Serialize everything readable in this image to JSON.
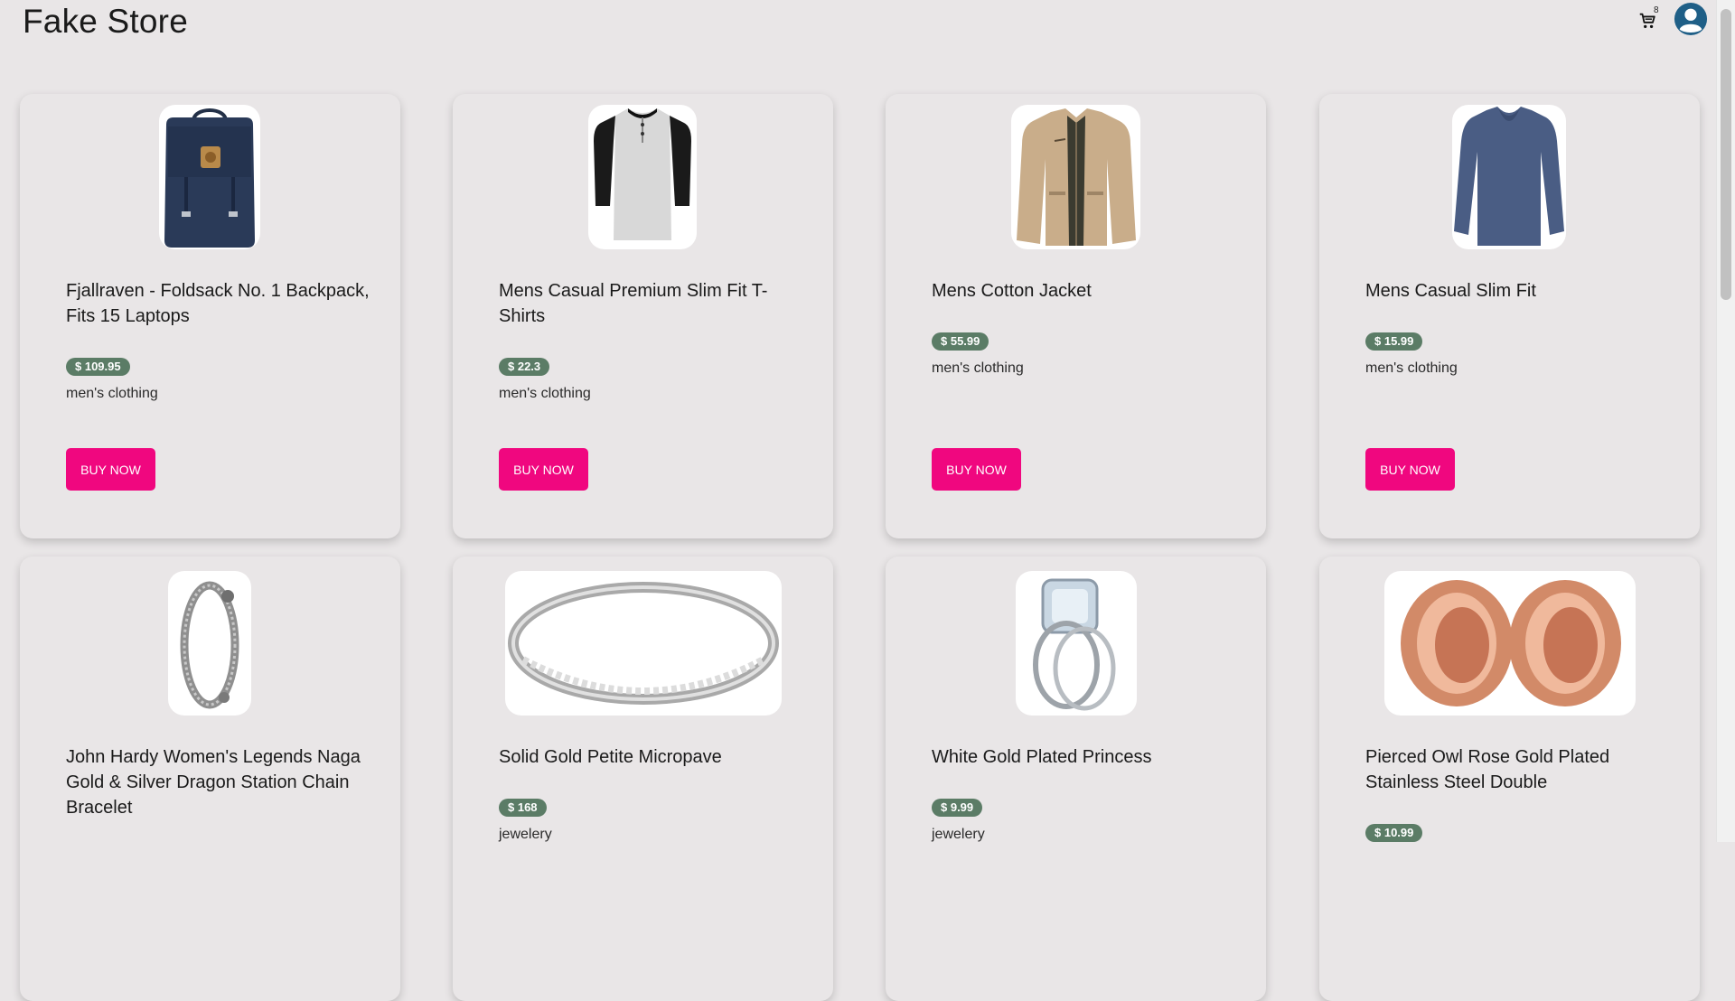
{
  "header": {
    "title": "Fake Store",
    "cart_count": "8",
    "icons": [
      "cart-icon",
      "account-avatar-icon"
    ]
  },
  "colors": {
    "price_badge": "#5b7c66",
    "buy_button": "#f0077f",
    "background": "#e9e6e7",
    "avatar": "#1f5f87"
  },
  "products": [
    {
      "title": "Fjallraven - Foldsack No. 1 Backpack, Fits 15 Laptops",
      "price": "$ 109.95",
      "category": "men's clothing",
      "button": "BUY NOW",
      "image_icon": "backpack-icon"
    },
    {
      "title": "Mens Casual Premium Slim Fit T-Shirts",
      "price": "$ 22.3",
      "category": "men's clothing",
      "button": "BUY NOW",
      "image_icon": "raglan-tshirt-icon"
    },
    {
      "title": "Mens Cotton Jacket",
      "price": "$ 55.99",
      "category": "men's clothing",
      "button": "BUY NOW",
      "image_icon": "jacket-icon"
    },
    {
      "title": "Mens Casual Slim Fit",
      "price": "$ 15.99",
      "category": "men's clothing",
      "button": "BUY NOW",
      "image_icon": "longsleeve-shirt-icon"
    },
    {
      "title": "John Hardy Women's Legends Naga Gold & Silver Dragon Station Chain Bracelet",
      "price": "",
      "category": "",
      "button": "",
      "image_icon": "bracelet-icon"
    },
    {
      "title": "Solid Gold Petite Micropave",
      "price": "$ 168",
      "category": "jewelery",
      "button": "",
      "image_icon": "ring-icon"
    },
    {
      "title": "White Gold Plated Princess",
      "price": "$ 9.99",
      "category": "jewelery",
      "button": "",
      "image_icon": "diamond-ring-icon"
    },
    {
      "title": "Pierced Owl Rose Gold Plated Stainless Steel Double",
      "price": "$ 10.99",
      "category": "",
      "button": "",
      "image_icon": "rose-gold-tunnels-icon"
    }
  ]
}
